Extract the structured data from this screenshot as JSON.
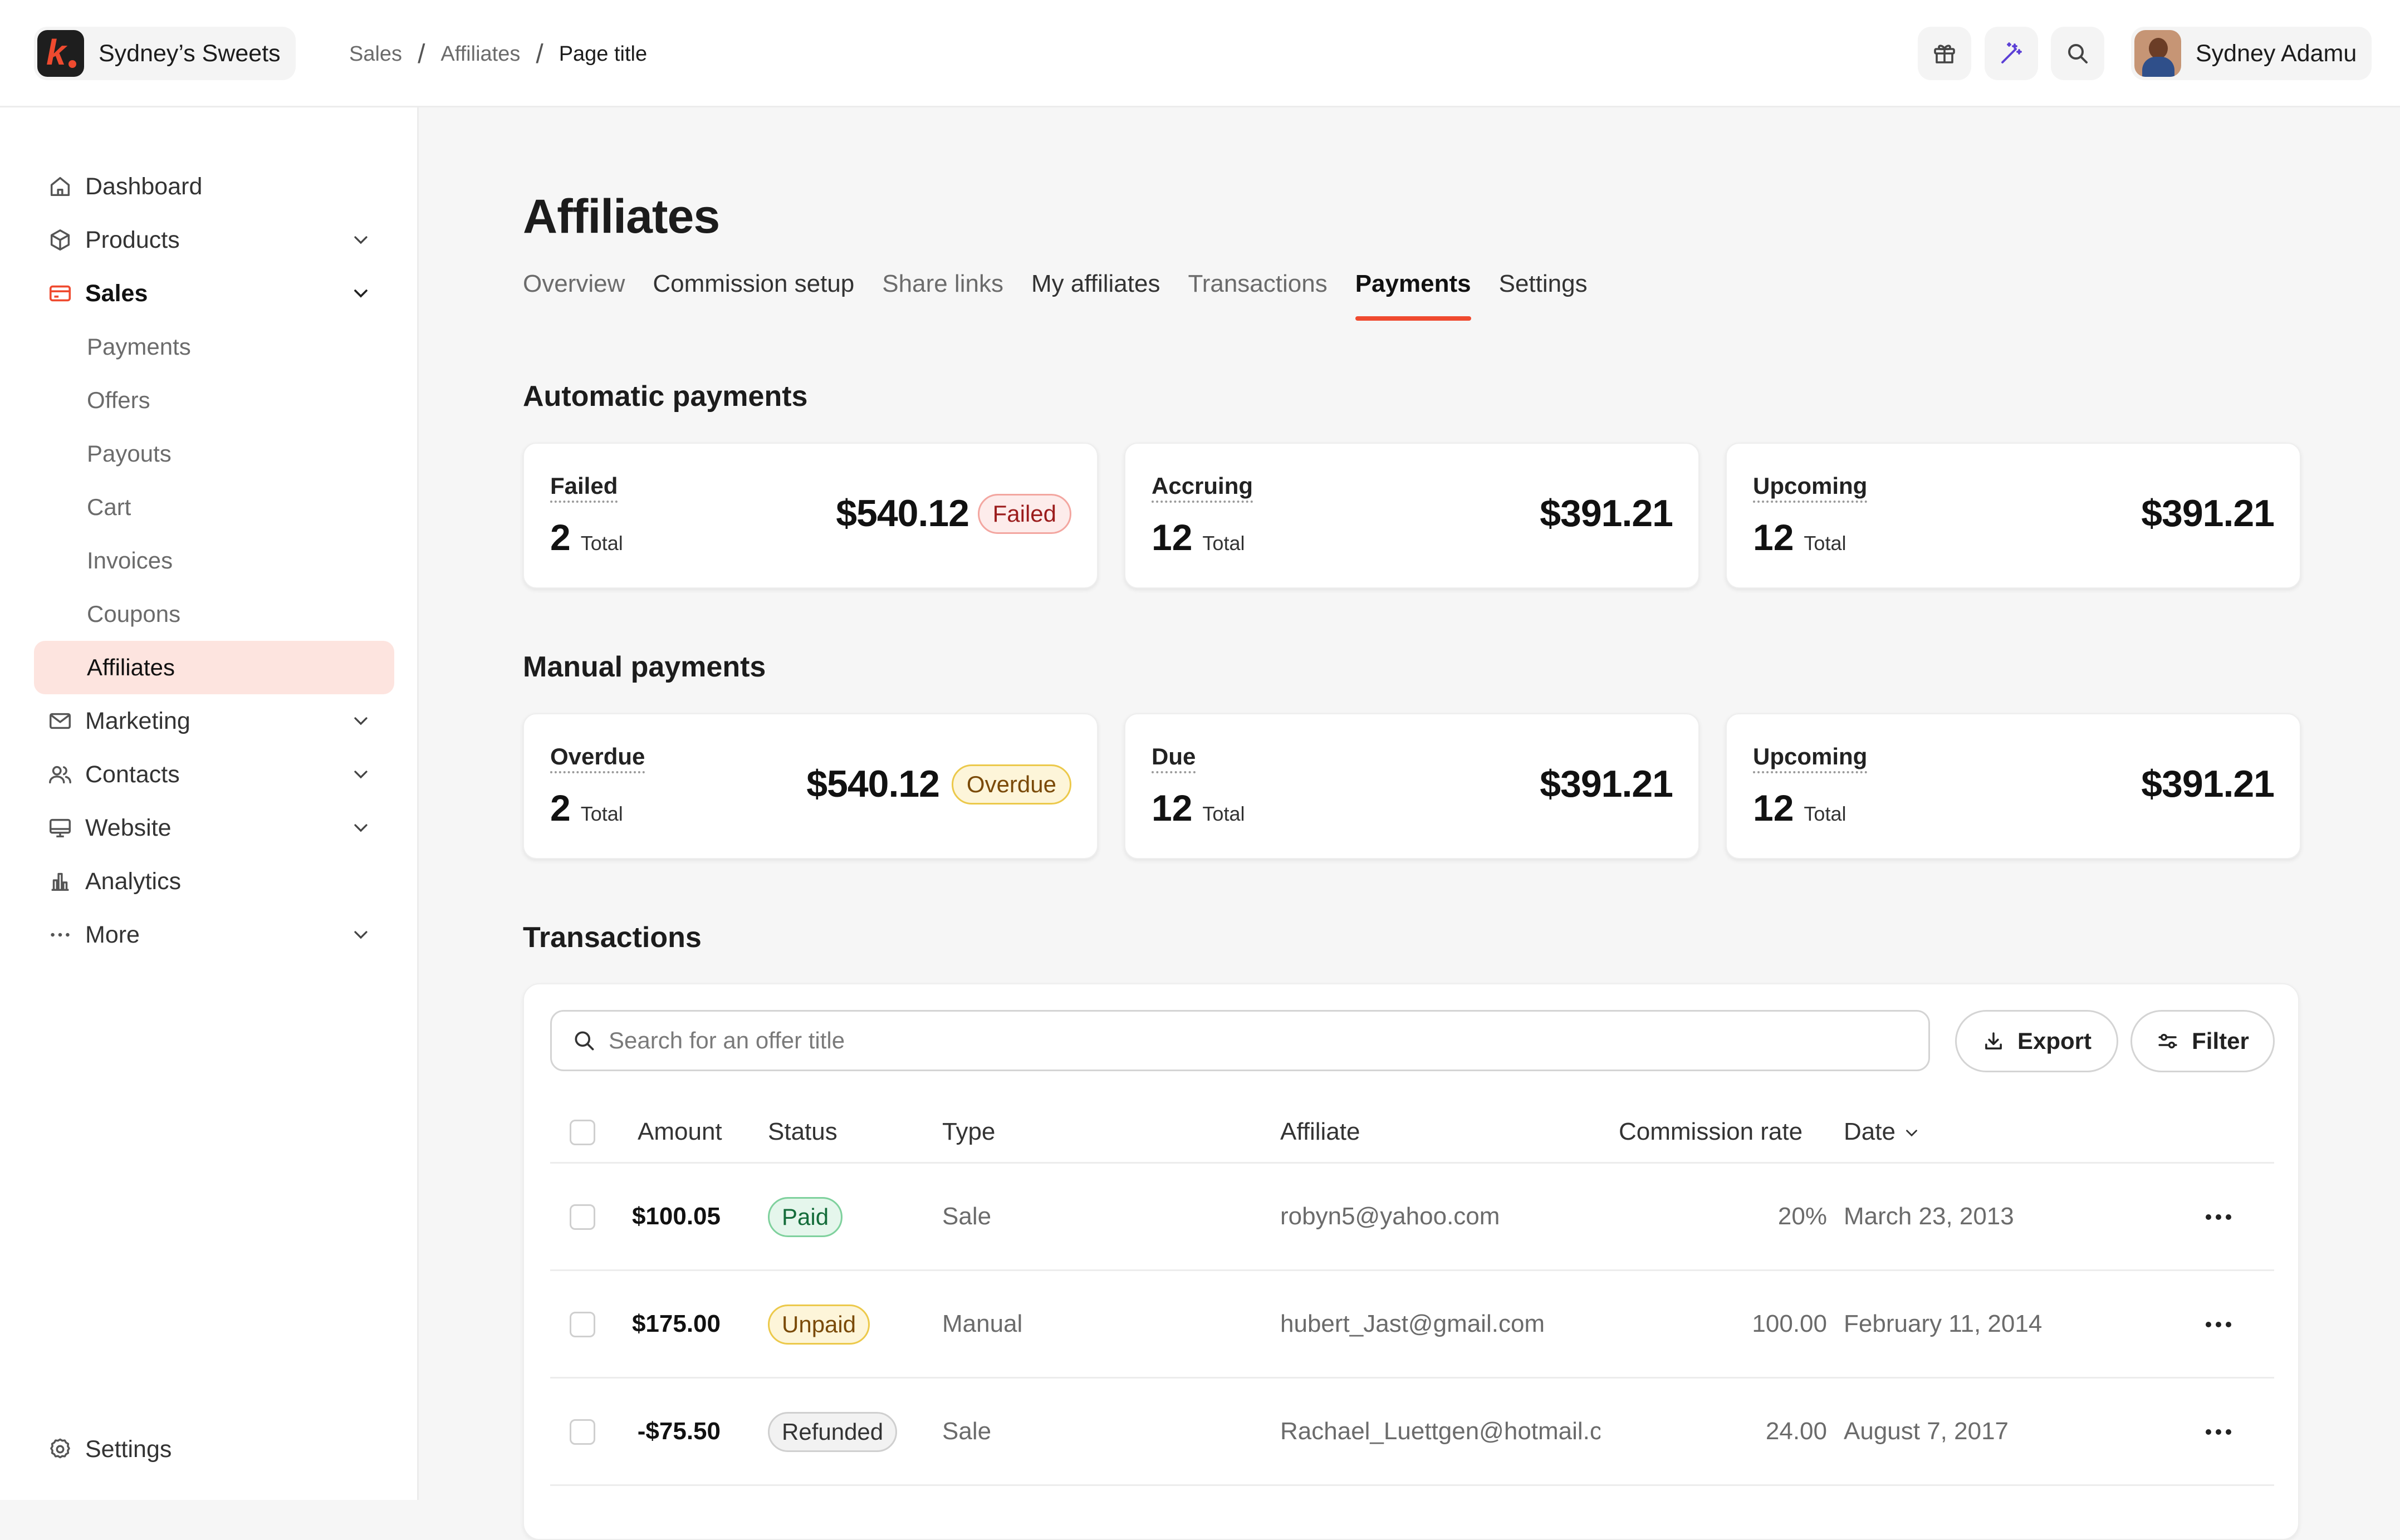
{
  "brand": {
    "name": "Sydney’s Sweets",
    "logo_letter": "k"
  },
  "breadcrumb": [
    "Sales",
    "Affiliates",
    "Page title"
  ],
  "breadcrumb_sep": "/",
  "topbar": {
    "icons": [
      "gift-icon",
      "magic-wand-icon",
      "search-icon"
    ],
    "user_name": "Sydney Adamu"
  },
  "sidebar": {
    "items": [
      {
        "label": "Dashboard",
        "icon": "home-icon"
      },
      {
        "label": "Products",
        "icon": "box-icon"
      },
      {
        "label": "Sales",
        "icon": "credit-card-icon"
      },
      {
        "label": "Marketing",
        "icon": "mail-icon"
      },
      {
        "label": "Contacts",
        "icon": "users-icon"
      },
      {
        "label": "Website",
        "icon": "monitor-icon"
      },
      {
        "label": "Analytics",
        "icon": "bar-chart-icon"
      },
      {
        "label": "More",
        "icon": "more-dots-icon"
      }
    ],
    "sales_sub": [
      "Payments",
      "Offers",
      "Payouts",
      "Cart",
      "Invoices",
      "Coupons",
      "Affiliates"
    ],
    "settings": "Settings",
    "accent": "#ef4a2f",
    "active_bg": "#fde4df"
  },
  "page": {
    "title": "Affiliates",
    "tabs": [
      "Overview",
      "Commission setup",
      "Share links",
      "My affiliates",
      "Transactions",
      "Payments",
      "Settings"
    ],
    "active_tab": "Payments"
  },
  "automatic": {
    "title": "Automatic payments",
    "cards": [
      {
        "label": "Failed",
        "count": "2",
        "total_label": "Total",
        "amount": "$540.12",
        "badge": "Failed"
      },
      {
        "label": "Accruing",
        "count": "12",
        "total_label": "Total",
        "amount": "$391.21"
      },
      {
        "label": "Upcoming",
        "count": "12",
        "total_label": "Total",
        "amount": "$391.21"
      }
    ]
  },
  "manual": {
    "title": "Manual payments",
    "cards": [
      {
        "label": "Overdue",
        "count": "2",
        "total_label": "Total",
        "amount": "$540.12",
        "badge": "Overdue"
      },
      {
        "label": "Due",
        "count": "12",
        "total_label": "Total",
        "amount": "$391.21"
      },
      {
        "label": "Upcoming",
        "count": "12",
        "total_label": "Total",
        "amount": "$391.21"
      }
    ]
  },
  "transactions": {
    "title": "Transactions",
    "search_placeholder": "Search for an offer title",
    "export_label": "Export",
    "filter_label": "Filter",
    "columns": [
      "Amount",
      "Status",
      "Type",
      "Affiliate",
      "Commission rate",
      "Date"
    ],
    "rows": [
      {
        "amount": "$100.05",
        "status": "Paid",
        "type": "Sale",
        "affiliate": "robyn5@yahoo.com",
        "rate": "20%",
        "date": "March 23, 2013"
      },
      {
        "amount": "$175.00",
        "status": "Unpaid",
        "type": "Manual",
        "affiliate": "hubert_Jast@gmail.com",
        "rate": "100.00",
        "date": "February 11, 2014"
      },
      {
        "amount": "-$75.50",
        "status": "Refunded",
        "type": "Sale",
        "affiliate": "Rachael_Luettgen@hotmail.com",
        "rate": "24.00",
        "date": "August 7, 2017"
      }
    ]
  }
}
